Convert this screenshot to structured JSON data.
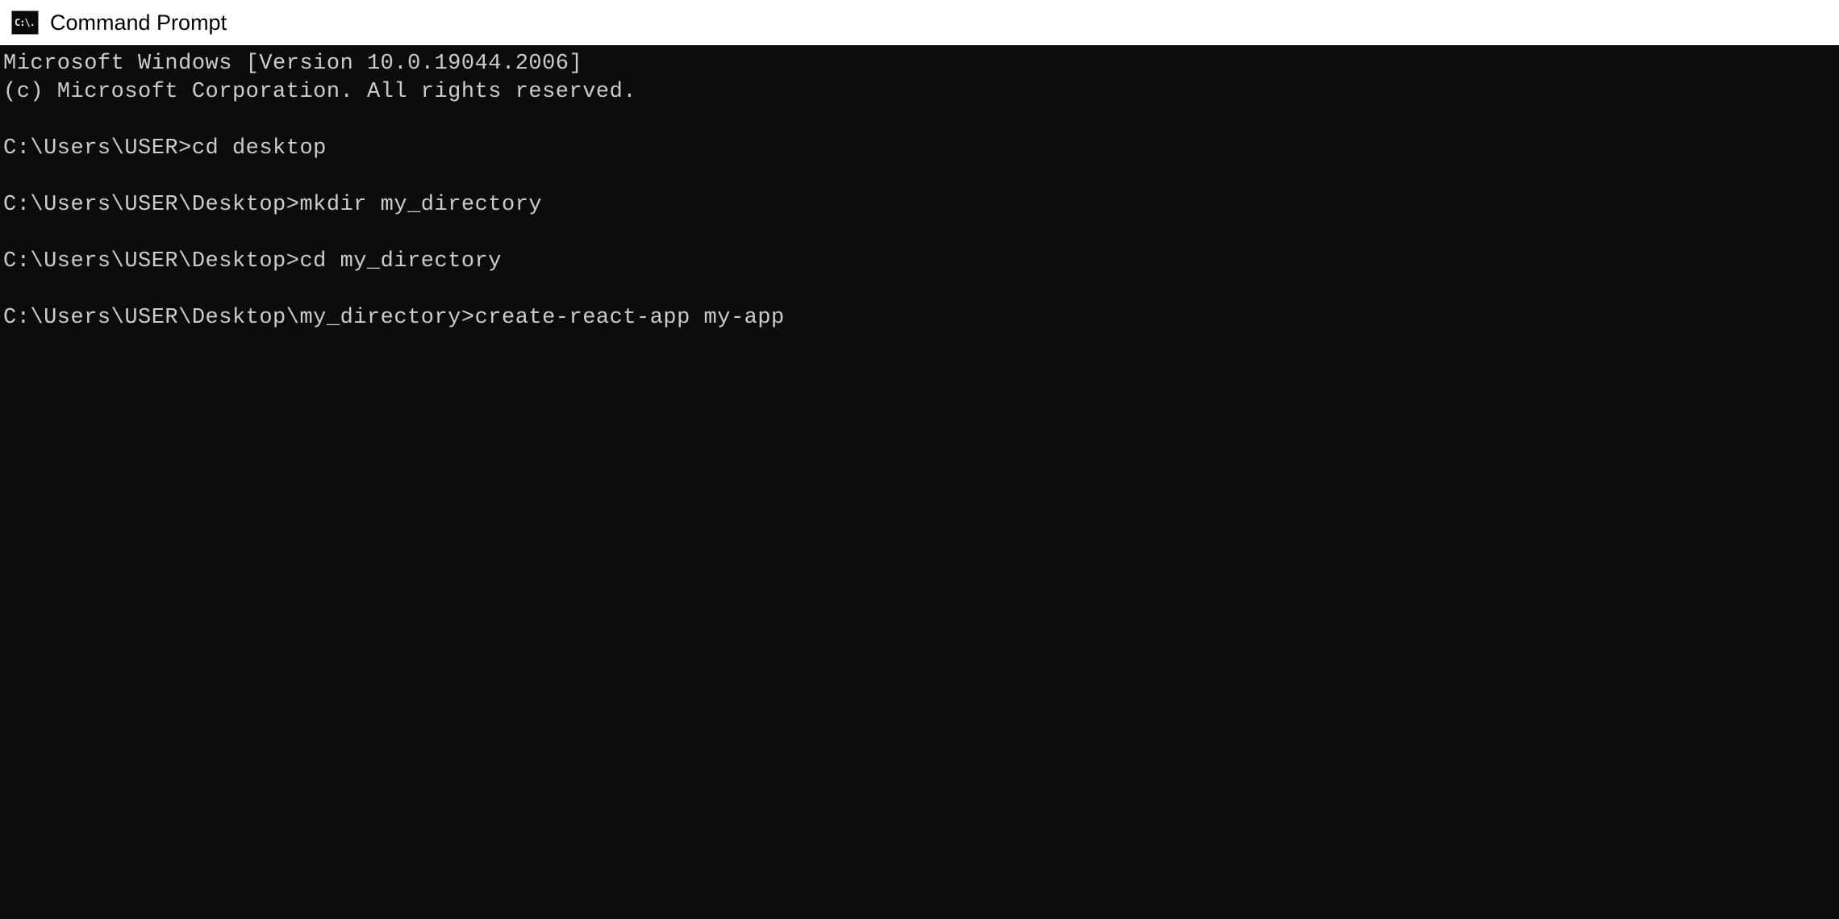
{
  "window": {
    "title": "Command Prompt",
    "icon_label": "C:\\."
  },
  "terminal": {
    "lines": [
      {
        "text": "Microsoft Windows [Version 10.0.19044.2006]"
      },
      {
        "text": "(c) Microsoft Corporation. All rights reserved."
      },
      {
        "blank": true
      },
      {
        "prompt": "C:\\Users\\USER>",
        "command": "cd desktop"
      },
      {
        "blank": true
      },
      {
        "prompt": "C:\\Users\\USER\\Desktop>",
        "command": "mkdir my_directory"
      },
      {
        "blank": true
      },
      {
        "prompt": "C:\\Users\\USER\\Desktop>",
        "command": "cd my_directory"
      },
      {
        "blank": true
      },
      {
        "prompt": "C:\\Users\\USER\\Desktop\\my_directory>",
        "command": "create-react-app my-app"
      }
    ]
  }
}
